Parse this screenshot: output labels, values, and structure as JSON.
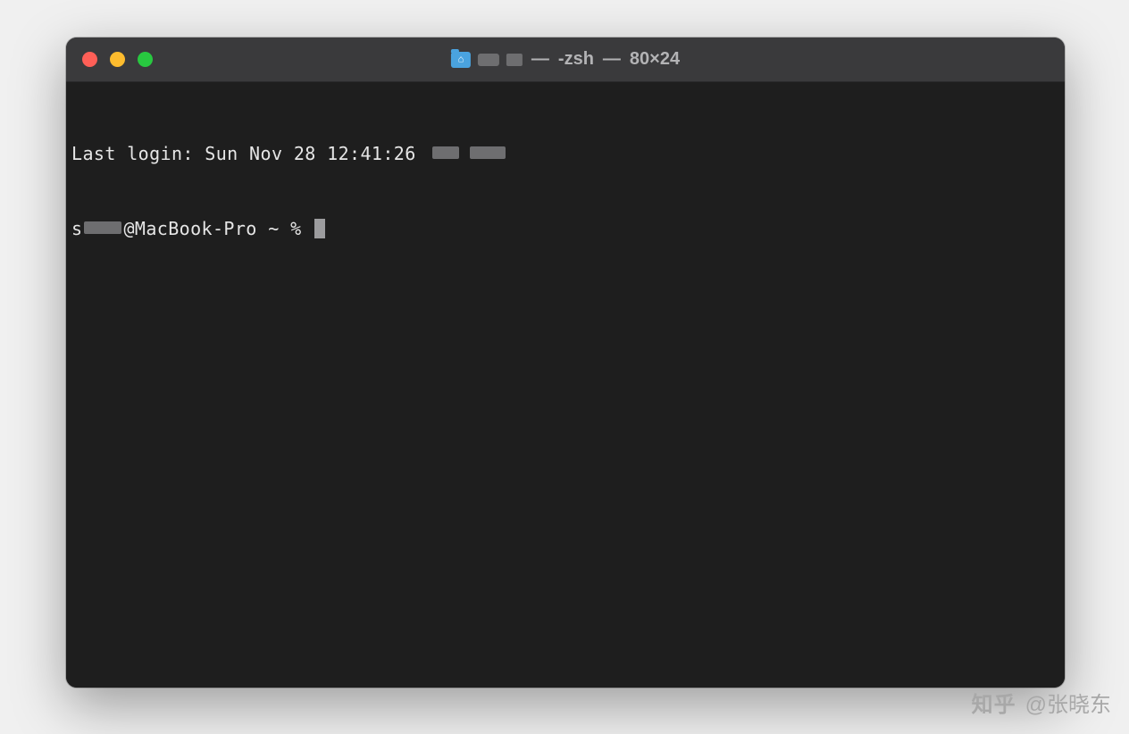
{
  "window": {
    "title_dash": "—",
    "title_shell": "-zsh",
    "title_dash2": "—",
    "title_dims": "80×24"
  },
  "terminal": {
    "last_login_prefix": "Last login: ",
    "last_login_time": "Sun Nov 28 12:41:26",
    "prompt_user_prefix": "s",
    "prompt_host": "@MacBook-Pro",
    "prompt_path": "~",
    "prompt_symbol": "%"
  },
  "watermark": {
    "site": "知乎",
    "at": "@张晓东"
  }
}
